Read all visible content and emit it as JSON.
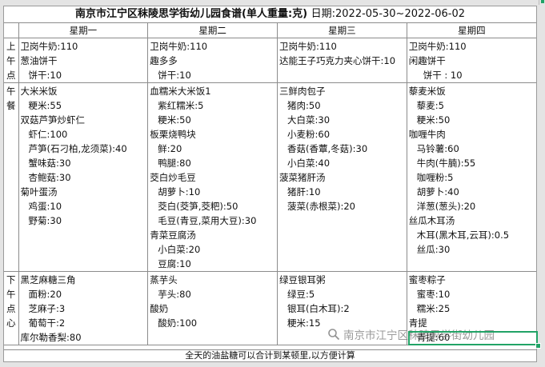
{
  "title": {
    "main": "南京市江宁区秣陵思学街幼儿园食谱(单人重量:克)",
    "dates": "日期:2022-05-30~2022-06-02"
  },
  "days": [
    "星期一",
    "星期二",
    "星期三",
    "星期四"
  ],
  "meals": [
    {
      "label": [
        "上",
        "午",
        "点"
      ],
      "cells": [
        [
          {
            "t": "卫岗牛奶:110",
            "k": "dish"
          },
          {
            "t": "葱油饼干",
            "k": "dish"
          },
          {
            "t": "饼干:10",
            "k": "ing"
          }
        ],
        [
          {
            "t": "卫岗牛奶:110",
            "k": "dish"
          },
          {
            "t": "趣多多",
            "k": "dish"
          },
          {
            "t": "饼干:10",
            "k": "ing"
          }
        ],
        [
          {
            "t": "卫岗牛奶:110",
            "k": "dish"
          },
          {
            "t": "达能王子巧克力夹心饼干:10",
            "k": "dish"
          }
        ],
        [
          {
            "t": "卫岗牛奶:110",
            "k": "dish"
          },
          {
            "t": "闲趣饼干",
            "k": "dish"
          },
          {
            "t": "饼干 : 10",
            "k": "deep"
          }
        ]
      ]
    },
    {
      "label": [
        "午",
        "餐"
      ],
      "cells": [
        [
          {
            "t": "大米米饭",
            "k": "dish"
          },
          {
            "t": "粳米:55",
            "k": "ing"
          },
          {
            "t": "双菇芦笋炒虾仁",
            "k": "dish"
          },
          {
            "t": "虾仁:100",
            "k": "ing"
          },
          {
            "t": "芦笋(石刁柏,龙须菜):40",
            "k": "ing"
          },
          {
            "t": "蟹味菇:30",
            "k": "ing"
          },
          {
            "t": "杏鲍菇:30",
            "k": "ing"
          },
          {
            "t": "菊叶蛋汤",
            "k": "dish"
          },
          {
            "t": "鸡蛋:10",
            "k": "ing"
          },
          {
            "t": "野菊:30",
            "k": "ing"
          }
        ],
        [
          {
            "t": "血糯米大米饭1",
            "k": "dish"
          },
          {
            "t": "紫红糯米:5",
            "k": "ing"
          },
          {
            "t": "粳米:50",
            "k": "ing"
          },
          {
            "t": "板栗烧鸭块",
            "k": "dish"
          },
          {
            "t": "鲜:20",
            "k": "ing"
          },
          {
            "t": "鸭腿:80",
            "k": "ing"
          },
          {
            "t": "茭白炒毛豆",
            "k": "dish"
          },
          {
            "t": "胡萝卜:10",
            "k": "ing"
          },
          {
            "t": "茭白(茭笋,茭粑):50",
            "k": "ing"
          },
          {
            "t": "毛豆(青豆,菜用大豆):30",
            "k": "ing"
          },
          {
            "t": "青菜豆腐汤",
            "k": "dish"
          },
          {
            "t": "小白菜:20",
            "k": "ing"
          },
          {
            "t": "豆腐:10",
            "k": "ing"
          }
        ],
        [
          {
            "t": "三鲜肉包子",
            "k": "dish"
          },
          {
            "t": "猪肉:50",
            "k": "ing"
          },
          {
            "t": "大白菜:30",
            "k": "ing"
          },
          {
            "t": "小麦粉:60",
            "k": "ing"
          },
          {
            "t": "香菇(香蕈,冬菇):30",
            "k": "ing"
          },
          {
            "t": "小白菜:40",
            "k": "ing"
          },
          {
            "t": "菠菜猪肝汤",
            "k": "dish"
          },
          {
            "t": "猪肝:10",
            "k": "ing"
          },
          {
            "t": "菠菜(赤根菜):20",
            "k": "ing"
          }
        ],
        [
          {
            "t": "藜麦米饭",
            "k": "dish"
          },
          {
            "t": "藜麦:5",
            "k": "ing"
          },
          {
            "t": "粳米:50",
            "k": "ing"
          },
          {
            "t": "咖喱牛肉",
            "k": "dish"
          },
          {
            "t": "马铃薯:60",
            "k": "ing"
          },
          {
            "t": "牛肉(牛腩):55",
            "k": "ing"
          },
          {
            "t": "咖喱粉:5",
            "k": "ing"
          },
          {
            "t": "胡萝卜:40",
            "k": "ing"
          },
          {
            "t": "洋葱(葱头):20",
            "k": "ing"
          },
          {
            "t": "丝瓜木耳汤",
            "k": "dish"
          },
          {
            "t": "木耳(黑木耳,云耳):0.5",
            "k": "ing"
          },
          {
            "t": "丝瓜:30",
            "k": "ing"
          }
        ]
      ]
    },
    {
      "label": [
        "下",
        "午",
        "点",
        "心"
      ],
      "cells": [
        [
          {
            "t": "黑芝麻糖三角",
            "k": "dish"
          },
          {
            "t": "面粉:20",
            "k": "ing"
          },
          {
            "t": "芝麻子:3",
            "k": "ing"
          },
          {
            "t": "葡萄干:2",
            "k": "ing"
          },
          {
            "t": "库尔勒香梨:80",
            "k": "dish"
          }
        ],
        [
          {
            "t": "蒸芋头",
            "k": "dish"
          },
          {
            "t": "芋头:80",
            "k": "ing"
          },
          {
            "t": "酸奶",
            "k": "dish"
          },
          {
            "t": "酸奶:100",
            "k": "ing"
          }
        ],
        [
          {
            "t": "绿豆银耳粥",
            "k": "dish"
          },
          {
            "t": "绿豆:5",
            "k": "ing"
          },
          {
            "t": "银耳(白木耳):2",
            "k": "ing"
          },
          {
            "t": "粳米:15",
            "k": "ing"
          }
        ],
        [
          {
            "t": "蜜枣粽子",
            "k": "dish"
          },
          {
            "t": "蜜枣:10",
            "k": "ing"
          },
          {
            "t": "糯米:25",
            "k": "ing"
          },
          {
            "t": "青提",
            "k": "dish"
          },
          {
            "t": "青提:60",
            "k": "ing"
          }
        ]
      ]
    }
  ],
  "footer": "全天的油盐糖可以合计到某顿里,以方便计算",
  "watermark": "南京市江宁区秣陵思学街幼儿园",
  "colors": {
    "accent": "#21a366",
    "grid": "#8c8c8c"
  }
}
